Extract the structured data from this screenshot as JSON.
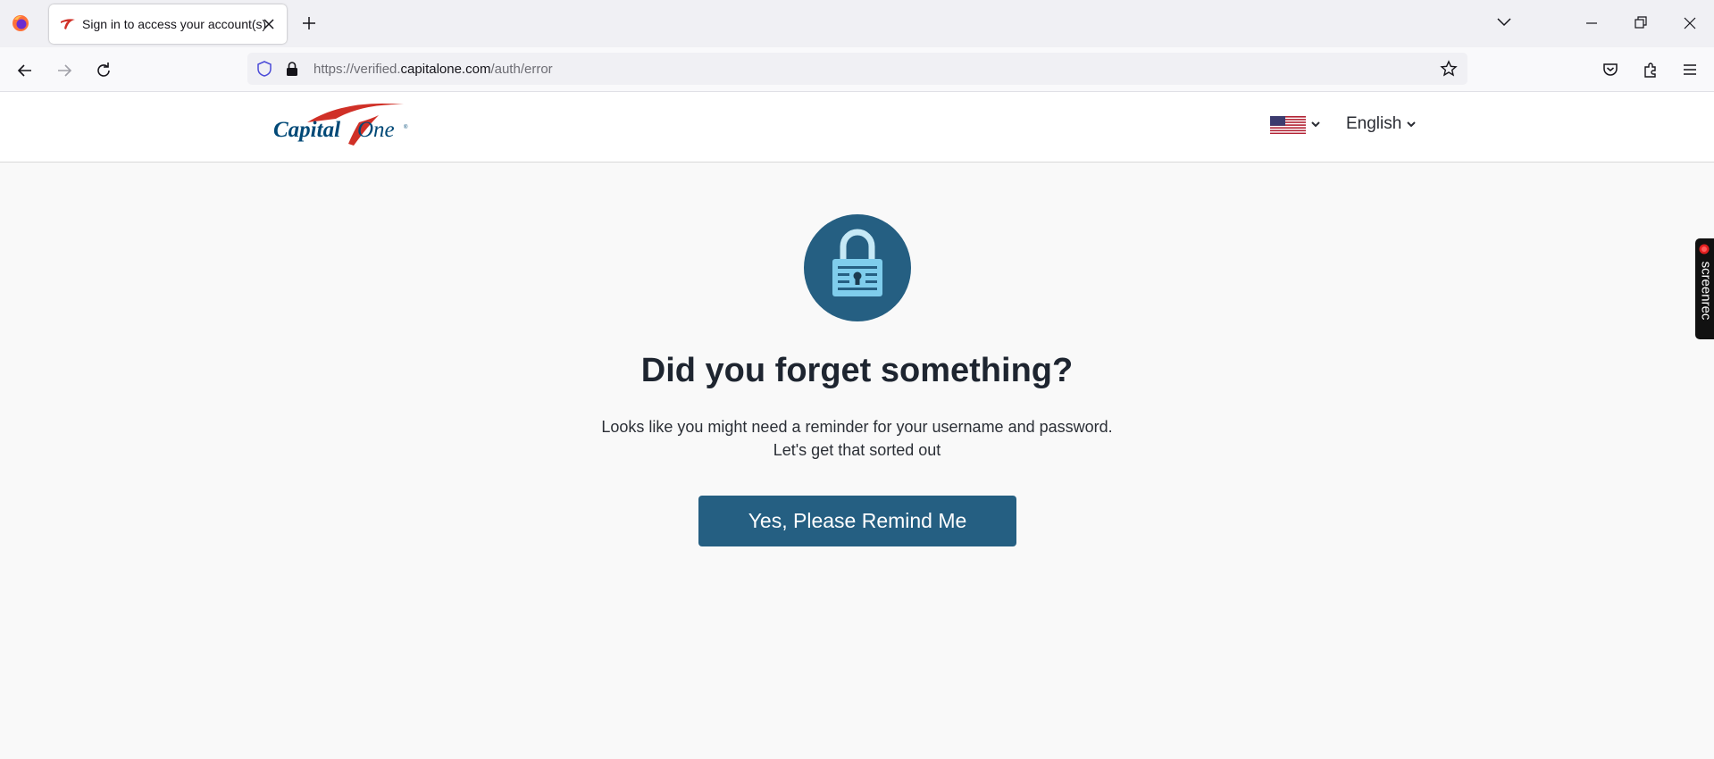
{
  "browser": {
    "tab_title": "Sign in to access your account(s)",
    "url_prefix": "https://verified.",
    "url_host": "capitalone.com",
    "url_path": "/auth/error"
  },
  "header": {
    "logo_text": "Capital One",
    "flag": "us-flag-icon",
    "language": "English"
  },
  "main": {
    "heading": "Did you forget something?",
    "message_line1": "Looks like you might need a reminder for your username and password.",
    "message_line2": "Let's get that sorted out",
    "button_label": "Yes, Please Remind Me"
  },
  "widgets": {
    "screenrec_label": "screenrec"
  },
  "colors": {
    "brand_blue": "#255f82",
    "lock_circle": "#255f82",
    "lock_body": "#7fcdec",
    "brand_red": "#d03027"
  }
}
